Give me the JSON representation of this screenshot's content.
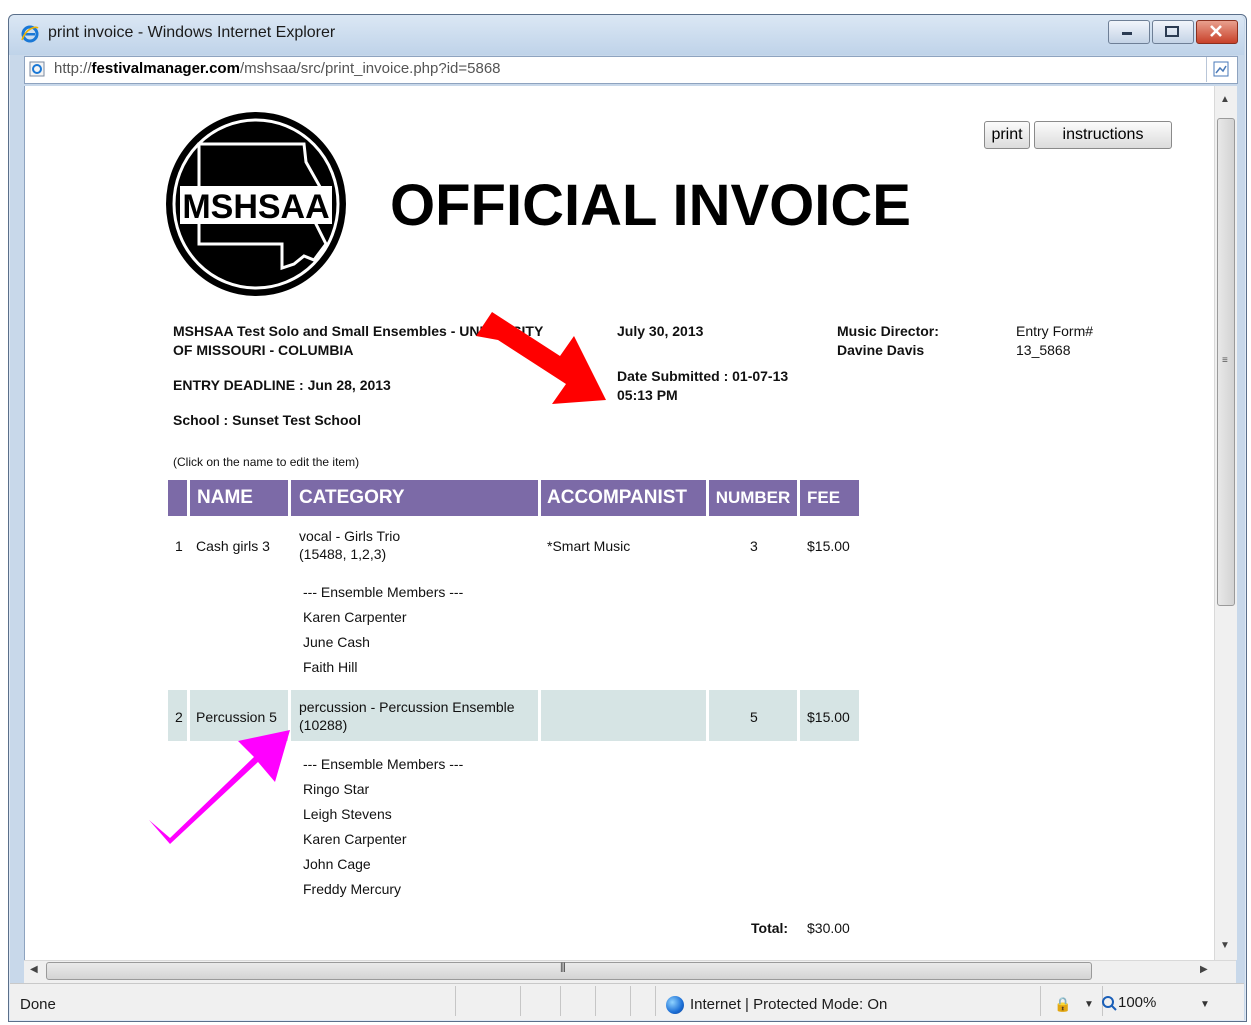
{
  "window": {
    "title": "print invoice - Windows Internet Explorer",
    "url_prefix": "http://",
    "url_domain": "festivalmanager.com",
    "url_path": "/mshsaa/src/print_invoice.php?id=5868"
  },
  "toolbar": {
    "print_label": "print",
    "instructions_label": "instructions"
  },
  "page": {
    "logo_text": "MSHSAA",
    "title": "OFFICIAL INVOICE",
    "event_line1": "MSHSAA Test Solo and Small Ensembles - UNIVERSITY",
    "event_line2": "OF MISSOURI - COLUMBIA",
    "deadline": "ENTRY DEADLINE : Jun 28, 2013",
    "school": "School : Sunset Test School",
    "event_date": "July 30, 2013",
    "date_submitted_line1": "Date Submitted : 01-07-13",
    "date_submitted_line2": "05:13 PM",
    "director_label": "Music Director:",
    "director_name": "Davine Davis",
    "entry_form_label": "Entry Form#",
    "entry_form_number": "13_5868",
    "edit_note": "(Click on the name to edit the item)"
  },
  "table": {
    "headers": {
      "name": "NAME",
      "category": "CATEGORY",
      "accompanist": "ACCOMPANIST",
      "number": "NUMBER",
      "fee": "FEE"
    },
    "rows": [
      {
        "index": "1",
        "name": "Cash girls 3",
        "category_line1": "vocal - Girls Trio",
        "category_line2": "(15488, 1,2,3)",
        "accompanist": "*Smart Music",
        "number": "3",
        "fee": "$15.00",
        "members_header": "--- Ensemble Members ---",
        "members": [
          "Karen Carpenter",
          "June Cash",
          "Faith Hill"
        ]
      },
      {
        "index": "2",
        "name": "Percussion 5",
        "category_line1": "percussion - Percussion Ensemble",
        "category_line2": "(10288)",
        "accompanist": "",
        "number": "5",
        "fee": "$15.00",
        "members_header": "--- Ensemble Members ---",
        "members": [
          "Ringo Star",
          "Leigh Stevens",
          "Karen Carpenter",
          "John Cage",
          "Freddy Mercury"
        ]
      }
    ],
    "total_label": "Total:",
    "total_value": "$30.00"
  },
  "status": {
    "left": "Done",
    "zone": "Internet | Protected Mode: On",
    "zoom": "100%"
  },
  "colors": {
    "header_bg": "#7c6aa7",
    "highlight_row": "#d6e4e4",
    "red_arrow": "#ff0000",
    "magenta_arrow": "#ff00ff"
  }
}
